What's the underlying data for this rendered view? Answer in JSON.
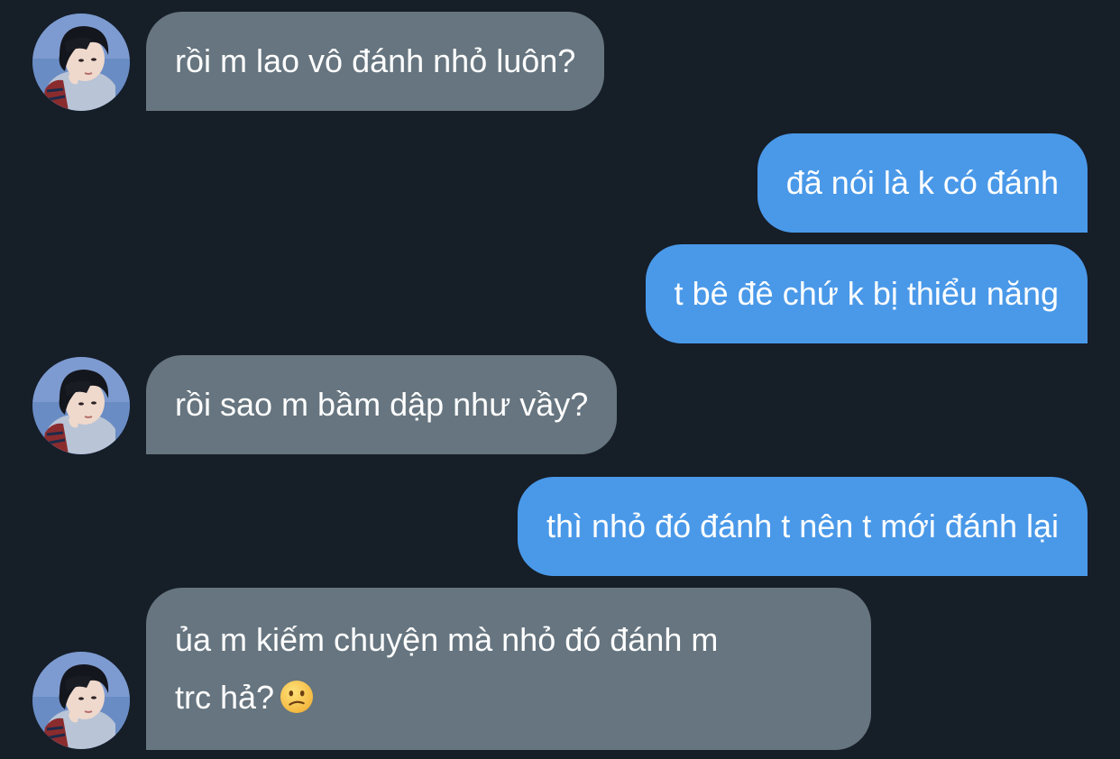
{
  "conversation": {
    "messages": [
      {
        "side": "incoming",
        "text": "rồi m lao vô đánh nhỏ luôn?"
      },
      {
        "side": "outgoing",
        "text": "đã nói là k có đánh"
      },
      {
        "side": "outgoing",
        "text": "t bê đê chứ k bị thiểu năng"
      },
      {
        "side": "incoming",
        "text": "rồi sao m bầm dập như vầy?"
      },
      {
        "side": "outgoing",
        "text": "thì nhỏ đó đánh t nên t mới đánh lại"
      },
      {
        "side": "incoming",
        "lines": [
          "ủa m kiếm chuyện mà nhỏ đó đánh m",
          "trc hả?"
        ],
        "emoji": "confused-face-emoji"
      }
    ]
  },
  "colors": {
    "background": "#161e28",
    "incoming_bubble": "#66757f",
    "outgoing_bubble": "#4a99e9",
    "text": "#ffffff"
  },
  "icons": {
    "avatar": "contact-avatar-photo",
    "emoji": "confused-face-emoji"
  }
}
